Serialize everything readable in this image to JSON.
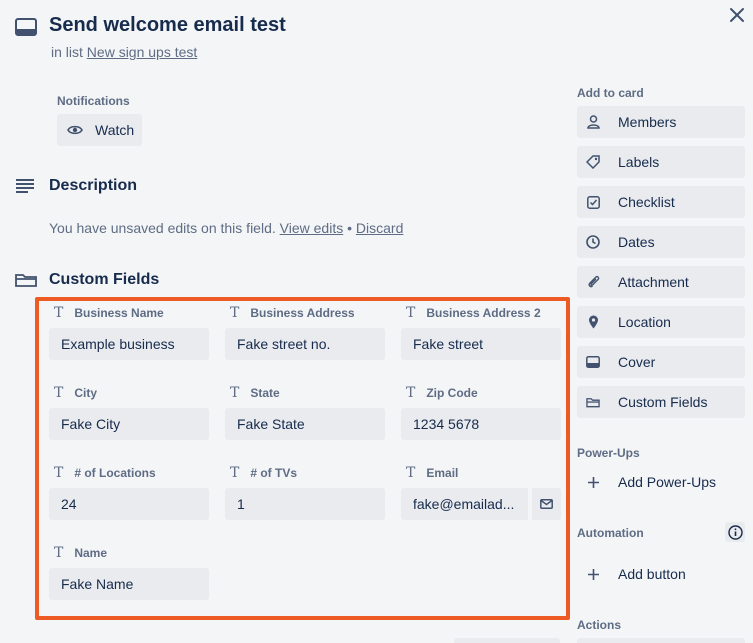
{
  "card": {
    "title": "Send welcome email test",
    "in_list_prefix": "in list",
    "list_name": "New sign ups test"
  },
  "notifications": {
    "label": "Notifications",
    "watch_label": "Watch"
  },
  "description": {
    "title": "Description",
    "unsaved_text": "You have unsaved edits on this field.",
    "view_edits": "View edits",
    "separator": "•",
    "discard": "Discard"
  },
  "custom_fields": {
    "title": "Custom Fields",
    "type_icon_glyph": "T",
    "fields": [
      {
        "label": "Business Name",
        "value": "Example business"
      },
      {
        "label": "Business Address",
        "value": "Fake street no."
      },
      {
        "label": "Business Address 2",
        "value": "Fake street"
      },
      {
        "label": "City",
        "value": "Fake City"
      },
      {
        "label": "State",
        "value": "Fake State"
      },
      {
        "label": "Zip Code",
        "value": "1234 5678"
      },
      {
        "label": "# of Locations",
        "value": "24"
      },
      {
        "label": "# of TVs",
        "value": "1"
      },
      {
        "label": "Email",
        "value": "fake@emailad..."
      },
      {
        "label": "Name",
        "value": "Fake Name"
      }
    ]
  },
  "sidebar": {
    "add_to_card_label": "Add to card",
    "add_to_card": [
      {
        "label": "Members",
        "icon": "person-icon"
      },
      {
        "label": "Labels",
        "icon": "tag-icon"
      },
      {
        "label": "Checklist",
        "icon": "checkbox-icon"
      },
      {
        "label": "Dates",
        "icon": "clock-icon"
      },
      {
        "label": "Attachment",
        "icon": "paperclip-icon"
      },
      {
        "label": "Location",
        "icon": "map-pin-icon"
      },
      {
        "label": "Cover",
        "icon": "card-cover-icon"
      },
      {
        "label": "Custom Fields",
        "icon": "custom-fields-icon"
      }
    ],
    "powerups_label": "Power-Ups",
    "add_powerups": "Add Power-Ups",
    "automation_label": "Automation",
    "add_button": "Add button",
    "actions_label": "Actions"
  },
  "colors": {
    "background": "#f4f5f7",
    "button_bg": "#e9ebee",
    "text_primary": "#172b4d",
    "text_secondary": "#5e6c84",
    "highlight_border": "#ee5a24"
  }
}
